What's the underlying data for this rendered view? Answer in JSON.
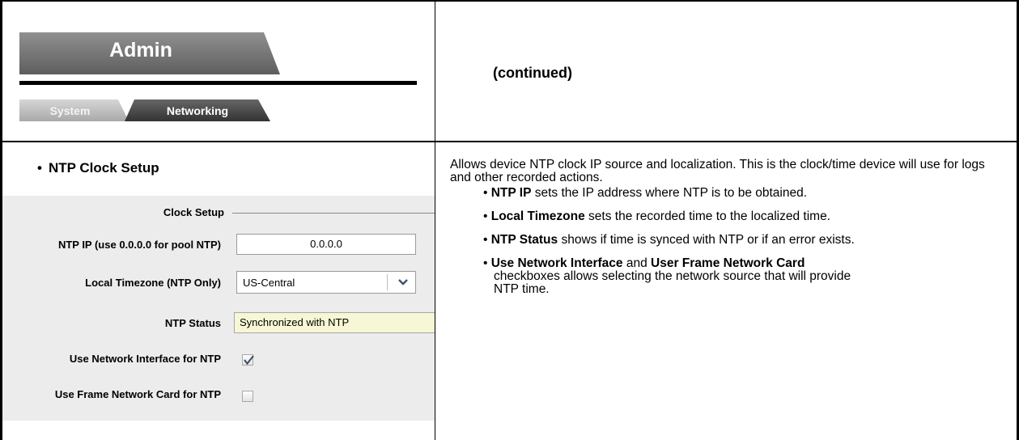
{
  "header": {
    "admin_tab_label": "Admin",
    "subtabs": [
      {
        "label": "System",
        "active": false
      },
      {
        "label": "Networking",
        "active": true
      }
    ],
    "continued_text": "(continued)"
  },
  "section": {
    "heading": "NTP Clock Setup",
    "panel_title": "Clock Setup",
    "fields": {
      "ntp_ip": {
        "label": "NTP IP (use 0.0.0.0 for pool NTP)",
        "value": "0.0.0.0"
      },
      "timezone": {
        "label": "Local Timezone (NTP Only)",
        "value": "US-Central"
      },
      "status": {
        "label": "NTP Status",
        "value": "Synchronized with NTP"
      },
      "use_network_interface": {
        "label": "Use Network Interface for NTP",
        "checked": true
      },
      "use_frame_card": {
        "label": "Use Frame Network Card for NTP",
        "checked": false
      }
    }
  },
  "description": {
    "intro": "Allows device NTP clock IP source and localization. This is the clock/time device will use for logs and other recorded actions.",
    "bullets": [
      {
        "term": "NTP IP",
        "text": " sets the IP address where NTP is to be obtained."
      },
      {
        "term": "Local Timezone",
        "text": " sets the recorded time to the localized time."
      },
      {
        "term": "NTP Status",
        "text": " shows if time is synced with NTP or if an error exists."
      }
    ],
    "last_bullet": {
      "term1": "Use Network Interface",
      "mid": " and ",
      "term2": "User Frame Network Card",
      "line2": "checkboxes allows selecting the network source that will provide",
      "line3": "NTP time."
    }
  },
  "colors": {
    "status_background": "#f7f7d5",
    "panel_background": "#ececec"
  }
}
